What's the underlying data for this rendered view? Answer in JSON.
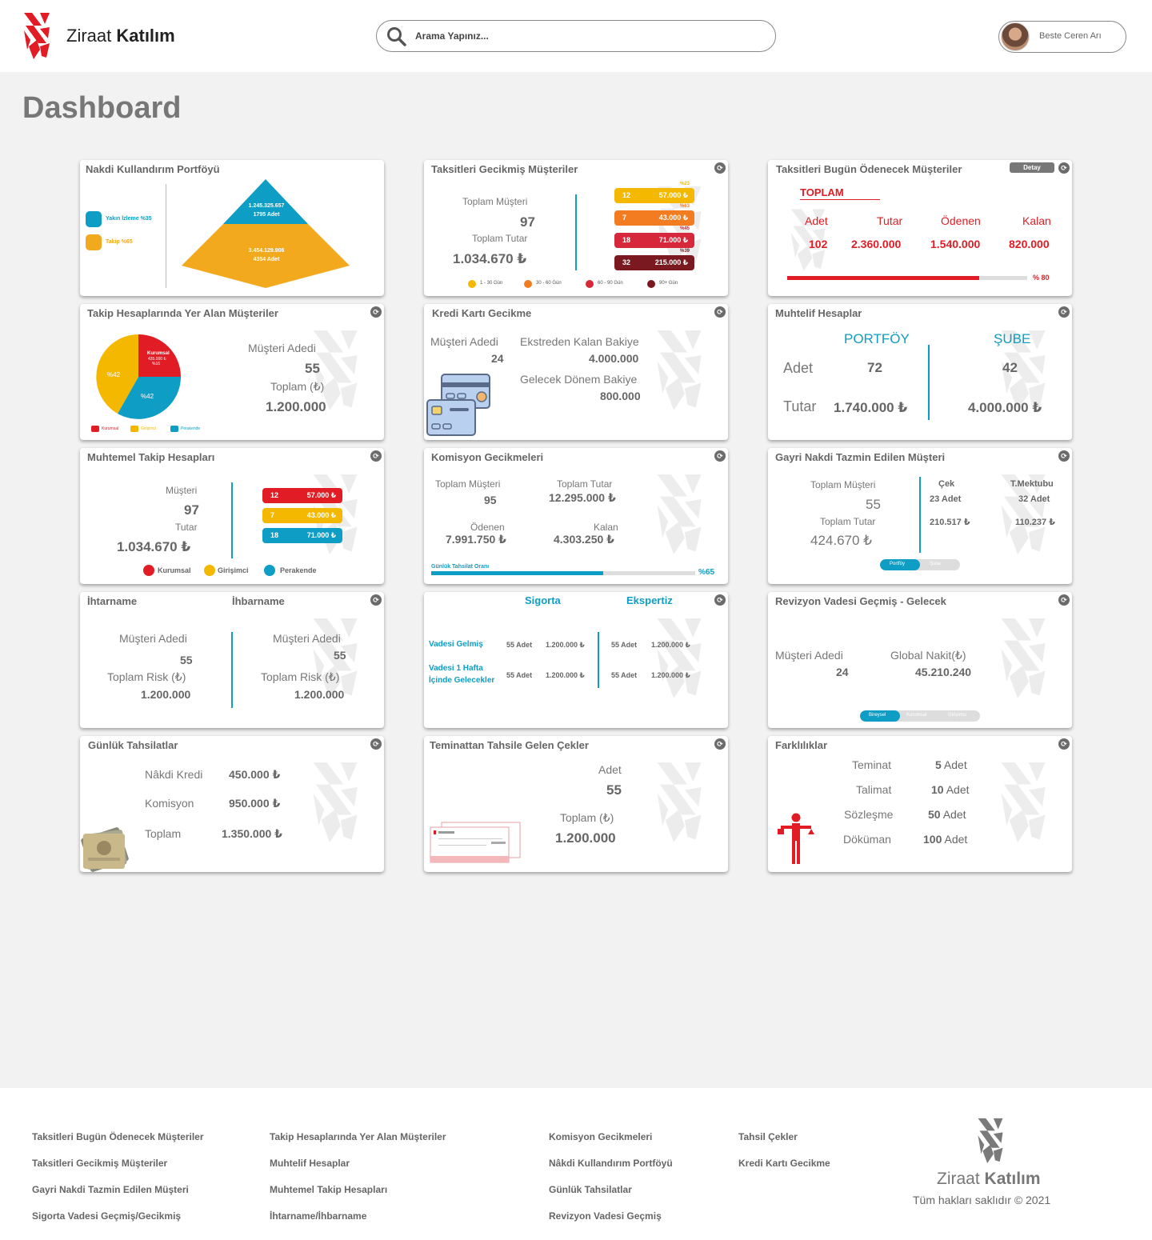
{
  "header": {
    "brand_light": "Ziraat",
    "brand_bold": "Katılım",
    "search_placeholder": "Arama Yapınız...",
    "user_name": "Beste Ceren Arı"
  },
  "page_title": "Dashboard",
  "colors": {
    "brand_red": "#e11c24",
    "accent_blue": "#0e9dc4",
    "accent_yellow": "#f5b800",
    "accent_orange": "#f47c20",
    "dark_red": "#7a1a20"
  },
  "cards": {
    "nakdi": {
      "title": "Nakdi Kullandırım Portföyü",
      "legend": [
        "Yakın İzleme %35",
        "Takip %65"
      ],
      "pyr_top_value": "1.245.325.657",
      "pyr_top_count": "1795 Adet",
      "pyr_bottom_value": "3.454.129.906",
      "pyr_bottom_count": "4354 Adet"
    },
    "taksit_gecikmis": {
      "title": "Taksitleri Gecikmiş Müşteriler",
      "lbl_musteri": "Toplam Müşteri",
      "musteri": "97",
      "lbl_tutar": "Toplam Tutar",
      "tutar": "1.034.670 ₺",
      "bars": [
        {
          "pct": "%23",
          "count": "12",
          "amount": "57.000 ₺"
        },
        {
          "pct": "%63",
          "count": "7",
          "amount": "43.000 ₺"
        },
        {
          "pct": "%45",
          "count": "18",
          "amount": "71.000 ₺"
        },
        {
          "pct": "%39",
          "count": "32",
          "amount": "215.000 ₺"
        }
      ],
      "legend": [
        "1 - 30 Gün",
        "30 - 60 Gün",
        "60 - 90 Gün",
        "90+ Gün"
      ]
    },
    "bugun_odenecek": {
      "title": "Taksitleri Bugün Ödenecek Müşteriler",
      "detay": "Detay",
      "toplam": "TOPLAM",
      "headers": [
        "Adet",
        "Tutar",
        "Ödenen",
        "Kalan"
      ],
      "values": [
        "102",
        "2.360.000",
        "1.540.000",
        "820.000"
      ],
      "progress": 80,
      "progress_label": "% 80"
    },
    "takip_hesap": {
      "title": "Takip Hesaplarında Yer Alan Müşteriler",
      "pie_kurumsal_label": "Kurumsal",
      "pie_kurumsal_value": "435.000 ₺",
      "pie_kurumsal_pct": "%16",
      "pie_yellow_pct": "%42",
      "pie_blue_pct": "%42",
      "lbl_musteri": "Müşteri Adedi",
      "musteri": "55",
      "lbl_toplam": "Toplam (₺)",
      "toplam": "1.200.000",
      "legend": [
        "Kurumsal",
        "Girişimci",
        "Perakende"
      ]
    },
    "kredi_karti": {
      "title": "Kredi Kartı Gecikme",
      "lbl_musteri": "Müşteri Adedi",
      "musteri": "24",
      "lbl_ekstre": "Ekstreden Kalan Bakiye",
      "ekstre": "4.000.000",
      "lbl_gelecek": "Gelecek Dönem Bakiye",
      "gelecek": "800.000"
    },
    "muhtelif": {
      "title": "Muhtelif Hesaplar",
      "portfoy": "PORTFÖY",
      "sube": "ŞUBE",
      "lbl_adet": "Adet",
      "lbl_tutar": "Tutar",
      "portfoy_adet": "72",
      "sube_adet": "42",
      "portfoy_tutar": "1.740.000 ₺",
      "sube_tutar": "4.000.000 ₺"
    },
    "muhtemel": {
      "title": "Muhtemel Takip Hesapları",
      "lbl_musteri": "Müşteri",
      "musteri": "97",
      "lbl_tutar": "Tutar",
      "tutar": "1.034.670 ₺",
      "bars": [
        {
          "count": "12",
          "amount": "57.000 ₺"
        },
        {
          "count": "7",
          "amount": "43.000 ₺"
        },
        {
          "count": "18",
          "amount": "71.000 ₺"
        }
      ],
      "legend": [
        "Kurumsal",
        "Girişimci",
        "Perakende"
      ]
    },
    "komisyon": {
      "title": "Komisyon Gecikmeleri",
      "lbl_musteri": "Toplam Müşteri",
      "musteri": "95",
      "lbl_tutar": "Toplam Tutar",
      "tutar": "12.295.000 ₺",
      "lbl_odenen": "Ödenen",
      "odenen": "7.991.750 ₺",
      "lbl_kalan": "Kalan",
      "kalan": "4.303.250 ₺",
      "progress_title": "Günlük Tahsilat Oranı",
      "progress": 65,
      "progress_label": "%65"
    },
    "gayri_nakdi": {
      "title": "Gayri Nakdi Tazmin Edilen Müşteri",
      "lbl_musteri": "Toplam Müşteri",
      "musteri": "55",
      "lbl_tutar": "Toplam Tutar",
      "tutar": "424.670 ₺",
      "cek": "Çek",
      "cek_adet": "23 Adet",
      "cek_tutar": "210.517 ₺",
      "mektup": "T.Mektubu",
      "mektup_adet": "32 Adet",
      "mektup_tutar": "110.237 ₺",
      "toggle": [
        "Portföy",
        "Şube"
      ]
    },
    "ihtarname": {
      "title_left": "İhtarname",
      "title_right": "İhbarname",
      "left_lbl_musteri": "Müşteri Adedi",
      "left_musteri": "55",
      "left_lbl_risk": "Toplam Risk (₺)",
      "left_risk": "1.200.000",
      "right_lbl_musteri": "Müşteri Adedi",
      "right_musteri": "55",
      "right_lbl_risk": "Toplam Risk (₺)",
      "right_risk": "1.200.000"
    },
    "sigorta": {
      "title_left": "Sigorta",
      "title_right": "Ekspertiz",
      "row1_label": "Vadesi Gelmiş",
      "row2_label_1": "Vadesi 1 Hafta",
      "row2_label_2": "İçinde Gelecekler",
      "s_r1_adet": "55 Adet",
      "s_r1_tutar": "1.200.000 ₺",
      "s_r2_adet": "55 Adet",
      "s_r2_tutar": "1.200.000 ₺",
      "e_r1_adet": "55 Adet",
      "e_r1_tutar": "1.200.000 ₺",
      "e_r2_adet": "55 Adet",
      "e_r2_tutar": "1.200.000 ₺"
    },
    "revizyon": {
      "title": "Revizyon Vadesi Geçmiş - Gelecek",
      "lbl_musteri": "Müşteri Adedi",
      "musteri": "24",
      "lbl_nakit": "Global Nakit(₺)",
      "nakit": "45.210.240",
      "toggle": [
        "Bireysel",
        "Kurumsal",
        "Girişimci"
      ]
    },
    "gunluk": {
      "title": "Günlük Tahsilatlar",
      "rows": [
        {
          "label": "Nâkdi Kredi",
          "value": "450.000 ₺"
        },
        {
          "label": "Komisyon",
          "value": "950.000 ₺"
        },
        {
          "label": "Toplam",
          "value": "1.350.000 ₺"
        }
      ]
    },
    "teminat": {
      "title": "Teminattan Tahsile Gelen Çekler",
      "lbl_adet": "Adet",
      "adet": "55",
      "lbl_toplam": "Toplam (₺)",
      "toplam": "1.200.000"
    },
    "farkliliklar": {
      "title": "Farklılıklar",
      "rows": [
        {
          "label": "Teminat",
          "count": "5",
          "unit": "Adet"
        },
        {
          "label": "Talimat",
          "count": "10",
          "unit": "Adet"
        },
        {
          "label": "Sözleşme",
          "count": "50",
          "unit": "Adet"
        },
        {
          "label": "Döküman",
          "count": "100",
          "unit": "Adet"
        }
      ]
    }
  },
  "footer": {
    "col1": [
      "Taksitleri Bugün Ödenecek Müşteriler",
      "Taksitleri Gecikmiş Müşteriler",
      "Gayri Nakdi Tazmin Edilen Müşteri",
      "Sigorta Vadesi Geçmiş/Gecikmiş"
    ],
    "col2": [
      "Takip Hesaplarında Yer Alan Müşteriler",
      "Muhtelif Hesaplar",
      "Muhtemel Takip Hesapları",
      "İhtarname/İhbarname"
    ],
    "col3": [
      "Komisyon Gecikmeleri",
      "Nâkdi Kullandırım Portföyü",
      "Günlük Tahsilatlar",
      "Revizyon Vadesi Geçmiş"
    ],
    "col4": [
      "Tahsil Çekler",
      "Kredi Kartı Gecikme"
    ],
    "brand_light": "Ziraat",
    "brand_bold": "Katılım",
    "copyright": "Tüm hakları saklıdır © 2021"
  }
}
